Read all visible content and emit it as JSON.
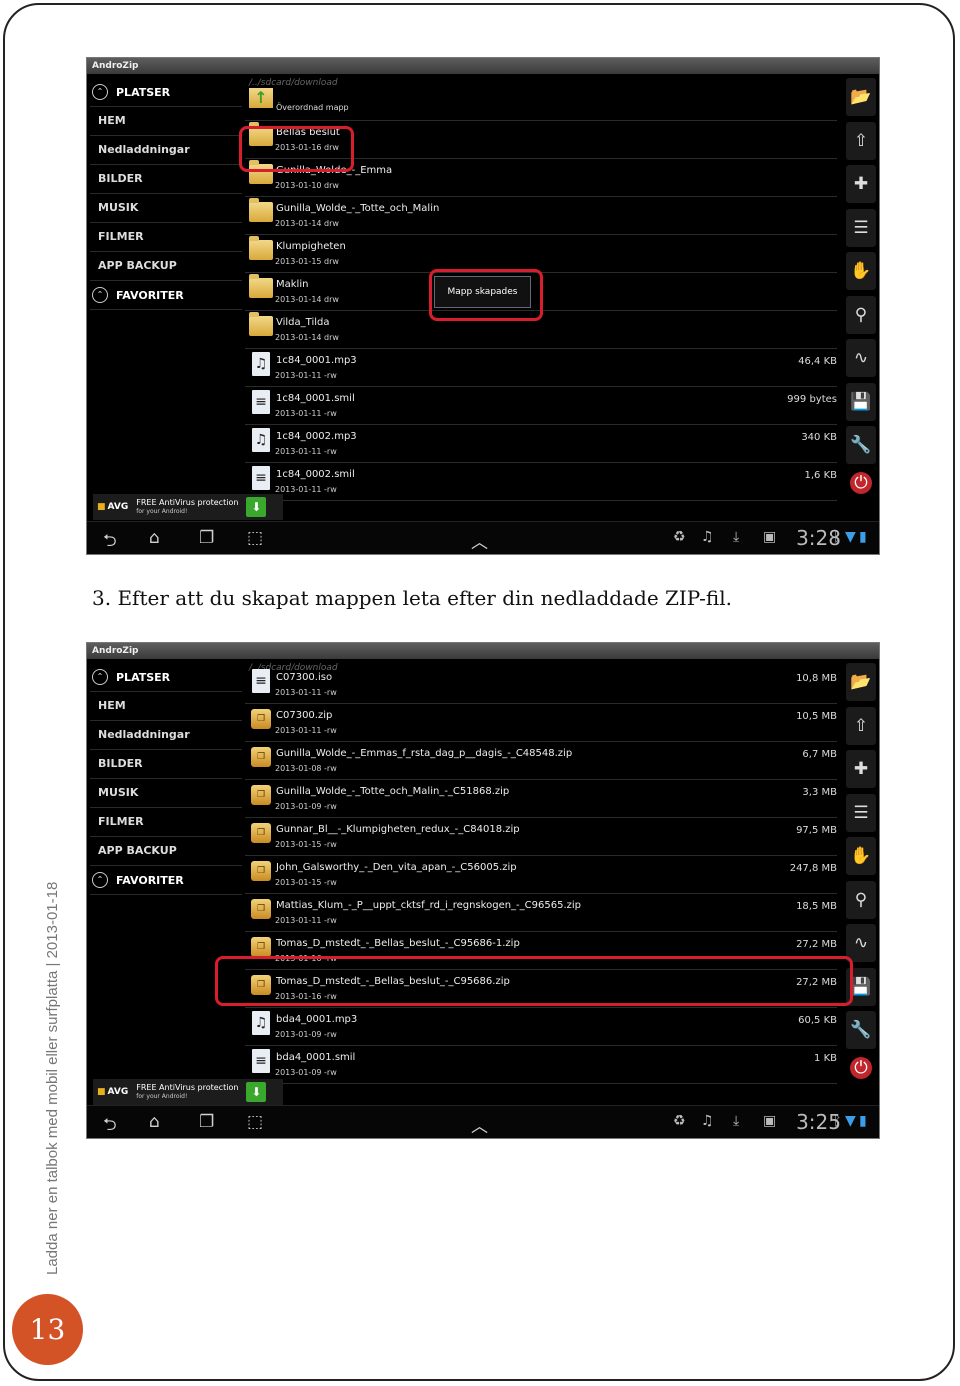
{
  "caption": "3.  Efter att du skapat mappen leta efter din nedladdade ZIP-fil.",
  "side_text": "Ladda ner en talbok med mobil eller surfplatta | 2013-01-18",
  "page_number": "13",
  "app_name": "AndroZip",
  "path": "/../sdcard/download",
  "sidebar": {
    "platser": "PLATSER",
    "items": [
      "HEM",
      "Nedladdningar",
      "BILDER",
      "MUSIK",
      "FILMER",
      "APP BACKUP"
    ],
    "favoriter": "FAVORITER"
  },
  "ad": {
    "brand": "AVG",
    "title": "FREE AntiVirus protection",
    "subtitle": "for your Android!"
  },
  "toast": "Mapp skapades",
  "screen1": {
    "clock": "3:28",
    "up_label": "Överordnad mapp",
    "rows": [
      {
        "type": "folder",
        "name": "Bellas beslut",
        "date": "2013-01-16 drw",
        "size": ""
      },
      {
        "type": "folder",
        "name": "Gunilla_Wolde_-_Emma",
        "date": "2013-01-10 drw",
        "size": ""
      },
      {
        "type": "folder",
        "name": "Gunilla_Wolde_-_Totte_och_Malin",
        "date": "2013-01-14 drw",
        "size": ""
      },
      {
        "type": "folder",
        "name": "Klumpigheten",
        "date": "2013-01-15 drw",
        "size": ""
      },
      {
        "type": "folder",
        "name": "Maklin",
        "date": "2013-01-14 drw",
        "size": ""
      },
      {
        "type": "folder",
        "name": "Vilda_Tilda",
        "date": "2013-01-14 drw",
        "size": ""
      },
      {
        "type": "audio",
        "name": "1c84_0001.mp3",
        "date": "2013-01-11 -rw",
        "size": "46,4 KB"
      },
      {
        "type": "doc",
        "name": "1c84_0001.smil",
        "date": "2013-01-11 -rw",
        "size": "999 bytes"
      },
      {
        "type": "audio",
        "name": "1c84_0002.mp3",
        "date": "2013-01-11 -rw",
        "size": "340 KB"
      },
      {
        "type": "doc",
        "name": "1c84_0002.smil",
        "date": "2013-01-11 -rw",
        "size": "1,6 KB"
      }
    ]
  },
  "screen2": {
    "clock": "3:25",
    "rows": [
      {
        "type": "doc",
        "name": "C07300.iso",
        "date": "2013-01-11 -rw",
        "size": "10,8 MB"
      },
      {
        "type": "zip",
        "name": "C07300.zip",
        "date": "2013-01-11 -rw",
        "size": "10,5 MB"
      },
      {
        "type": "zip",
        "name": "Gunilla_Wolde_-_Emmas_f_rsta_dag_p__dagis_-_C48548.zip",
        "date": "2013-01-08 -rw",
        "size": "6,7 MB"
      },
      {
        "type": "zip",
        "name": "Gunilla_Wolde_-_Totte_och_Malin_-_C51868.zip",
        "date": "2013-01-09 -rw",
        "size": "3,3 MB"
      },
      {
        "type": "zip",
        "name": "Gunnar_Bl__-_Klumpigheten_redux_-_C84018.zip",
        "date": "2013-01-15 -rw",
        "size": "97,5 MB"
      },
      {
        "type": "zip",
        "name": "John_Galsworthy_-_Den_vita_apan_-_C56005.zip",
        "date": "2013-01-15 -rw",
        "size": "247,8 MB"
      },
      {
        "type": "zip",
        "name": "Mattias_Klum_-_P__uppt_cktsf_rd_i_regnskogen_-_C96565.zip",
        "date": "2013-01-11 -rw",
        "size": "18,5 MB"
      },
      {
        "type": "zip",
        "name": "Tomas_D_mstedt_-_Bellas_beslut_-_C95686-1.zip",
        "date": "2013-01-16 -rw",
        "size": "27,2 MB"
      },
      {
        "type": "zip",
        "name": "Tomas_D_mstedt_-_Bellas_beslut_-_C95686.zip",
        "date": "2013-01-16 -rw",
        "size": "27,2 MB"
      },
      {
        "type": "audio",
        "name": "bda4_0001.mp3",
        "date": "2013-01-09 -rw",
        "size": "60,5 KB"
      },
      {
        "type": "doc",
        "name": "bda4_0001.smil",
        "date": "2013-01-09 -rw",
        "size": "1 KB"
      }
    ]
  },
  "icons": {
    "toolbar": [
      "folder-home-icon",
      "folder-up-icon",
      "new-folder-icon",
      "multi-select-icon",
      "hand-icon",
      "search-icon",
      "cpu-icon",
      "save-icon",
      "tools-icon",
      "power-icon"
    ],
    "nav": [
      "back-icon",
      "home-icon",
      "recent-apps-icon",
      "screenshot-icon",
      "up-arrow-icon"
    ],
    "status": [
      "recycle-icon",
      "music-icon",
      "download-icon",
      "shop-icon",
      "bluetooth-icon",
      "wifi-icon",
      "battery-icon"
    ]
  },
  "colors": {
    "highlight": "#d81e2c",
    "page_badge": "#d35226",
    "folder": "#e2bf60",
    "ok_green": "#3aa82c"
  }
}
